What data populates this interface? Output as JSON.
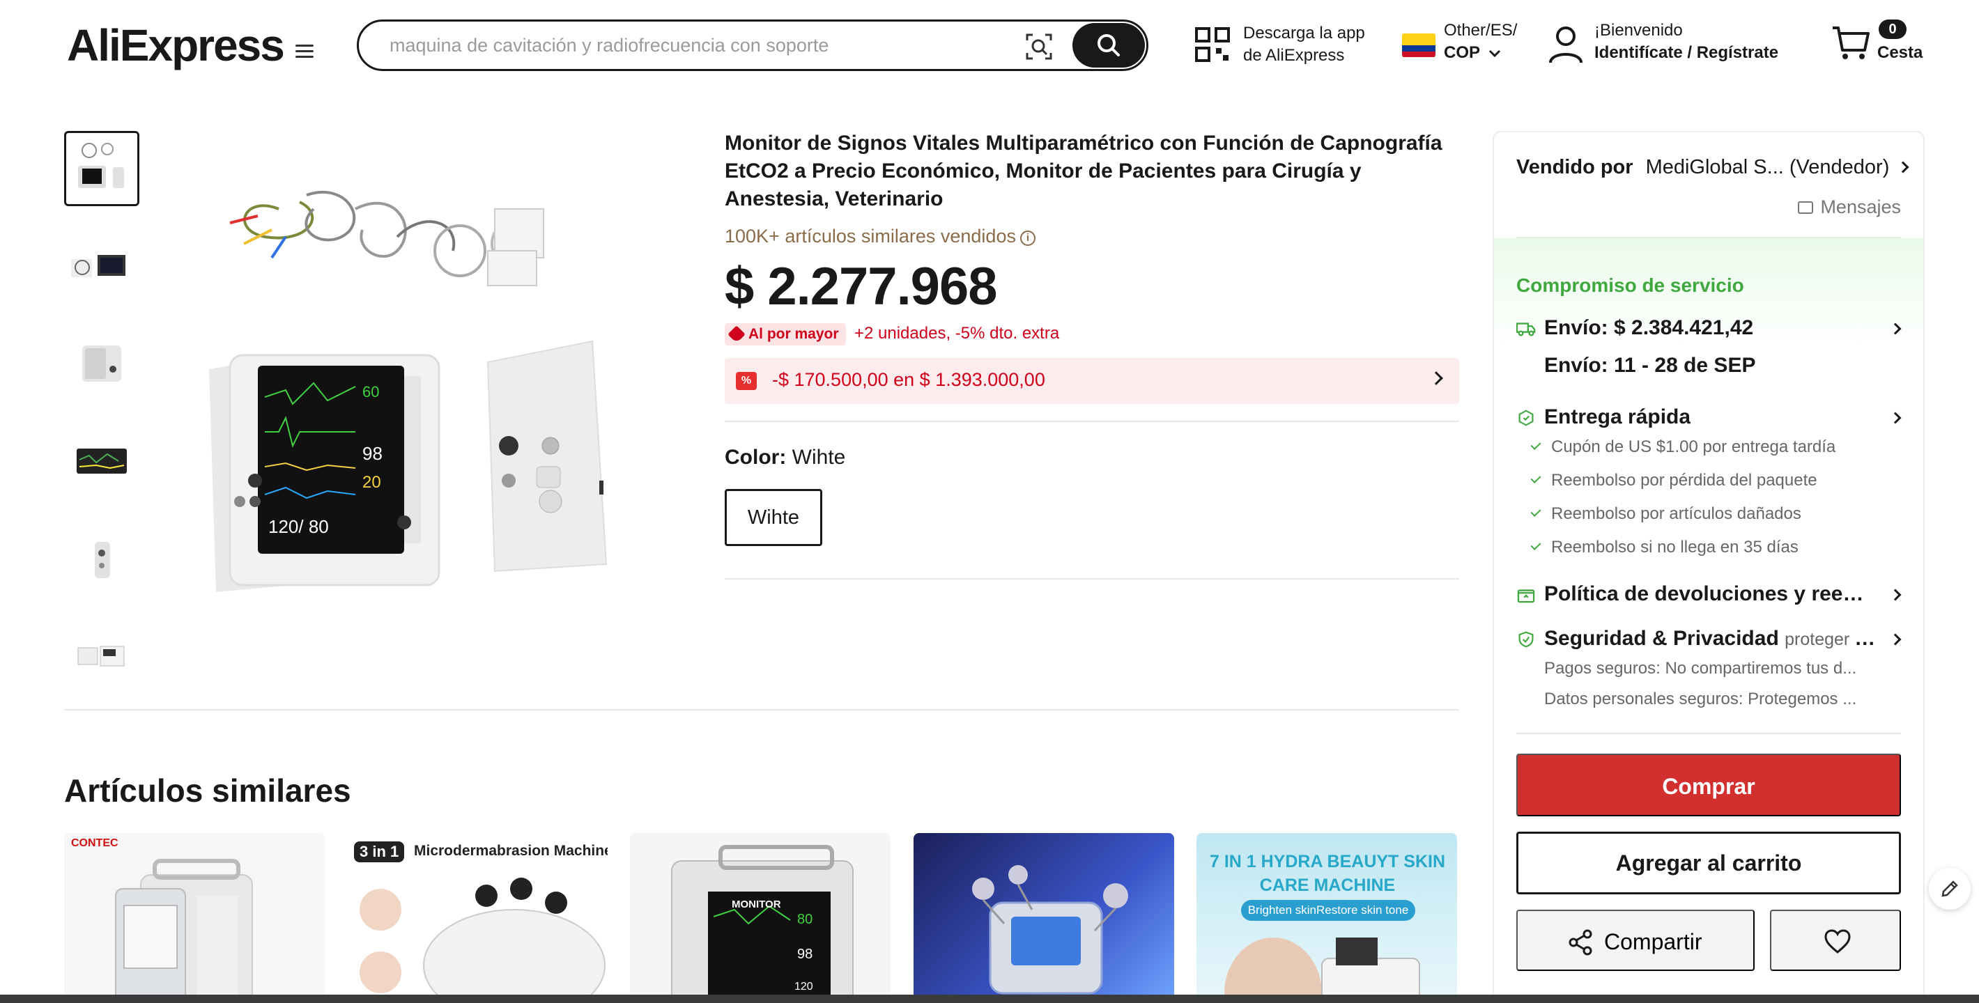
{
  "header": {
    "logo": "AliExpress",
    "search_placeholder": "maquina de cavitación y radiofrecuencia con soporte",
    "app_download": [
      "Descarga la app",
      "de AliExpress"
    ],
    "locale_line1": "Other/ES/",
    "locale_line2": "COP",
    "account_line1": "¡Bienvenido",
    "account_line2": "Identifícate / Regístrate",
    "cart_count": "0",
    "cart_label": "Cesta"
  },
  "product": {
    "title": "Monitor de Signos Vitales Multiparamétrico con Función de Capnografía EtCO2 a Precio Económico, Monitor de Pacientes para Cirugía y Anestesia, Veterinario",
    "sold": "100K+ artículos similares vendidos",
    "price": "$ 2.277.968",
    "bulk_badge": "Al por mayor",
    "bulk_text": "+2 unidades, -5% dto. extra",
    "coupon_text": "-$ 170.500,00 en $ 1.393.000,00",
    "color_label": "Color:",
    "color_value": "Wihte",
    "sku_option": "Wihte"
  },
  "similar": {
    "title": "Artículos similares",
    "items": [
      {
        "badge": "CONTEC"
      },
      {
        "badge": "3 in 1",
        "caption": "Microdermabrasion Machine"
      },
      {
        "badge": "MONITOR"
      },
      {
        "badge": ""
      },
      {
        "badge": "7 IN 1 HYDRA BEAUYT SKIN CARE MACHINE",
        "caption": "Brighten skinRestore skin tone"
      }
    ]
  },
  "panel": {
    "seller_label": "Vendido por",
    "seller_name": "MediGlobal S... (Vendedor)",
    "messages": "Mensajes",
    "commitment": "Compromiso de servicio",
    "shipping_cost": "Envío: $ 2.384.421,42",
    "shipping_dates": "Envío: 11 - 28 de SEP",
    "fast_delivery": "Entrega rápida",
    "fast_items": [
      "Cupón de US $1.00 por entrega tardía",
      "Reembolso por pérdida del paquete",
      "Reembolso por artículos dañados",
      "Reembolso si no llega en 35 días"
    ],
    "returns": "Política de devoluciones y reembo...",
    "security": "Seguridad & Privacidad",
    "security_sub": "proteger dat...",
    "security_items": [
      "Pagos seguros: No compartiremos tus d...",
      "Datos personales seguros: Protegemos ..."
    ],
    "buy": "Comprar",
    "add_to_cart": "Agregar al carrito",
    "share": "Compartir"
  },
  "colors": {
    "brand_red": "#d22f2f",
    "accent_orange": "#ff7a00",
    "success_green": "#3fa83f",
    "sold_brown": "#8a6b4a"
  }
}
